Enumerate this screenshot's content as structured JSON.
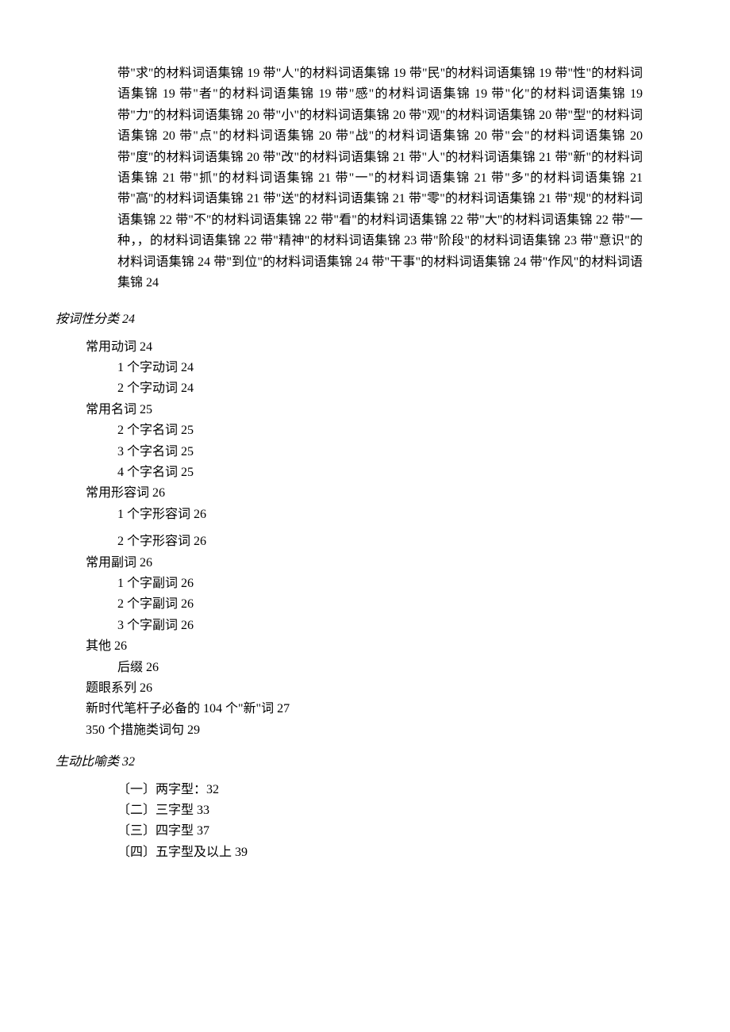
{
  "para1": "带\"求''的材料词语集锦 19 带\"人\"的材料词语集锦 19 带\"民''的材料词语集锦 19 带\"性\"的材料词语集锦 19 带\"者\"的材料词语集锦 19 带\"感\"的材料词语集锦 19 带\"化''的材料词语集锦 19 带\"力''的材料词语集锦 20 带\"小\"的材料词语集锦 20 带\"观\"的材料词语集锦 20 带\"型\"的材料词语集锦 20 带\"点\"的材料词语集锦 20 带\"战''的材料词语集锦 20 带\"会''的材料词语集锦 20 带\"度''的材料词语集锦 20 带\"改\"的材料词语集锦 21 带\"人\"的材料词语集锦 21 带\"新\"的材料词语集锦 21 带\"抓''的材料词语集锦 21 带\"一''的材料词语集锦 21 带\"多''的材料词语集锦 21 带\"高''的材料词语集锦 21 带\"送''的材料词语集锦 21 带\"零\"的材料词语集锦 21 带\"规\"的材料词语集锦 22 带\"不''的材料词语集锦 22 带\"看\"的材料词语集锦 22 带\"大''的材料词语集锦 22 带\"一种，，的材料词语集锦 22 带\"精神\"的材料词语集锦 23 带\"阶段\"的材料词语集锦 23 带\"意识\"的材料词语集锦 24 带\"到位\"的材料词语集锦 24 带\"干事\"的材料词语集锦 24 带\"作风\"的材料词语集锦 24",
  "sec1": {
    "title": "按词性分类 24",
    "items": [
      {
        "label": "常用动词 24",
        "sub": [
          "1 个字动词 24",
          "2 个字动词 24"
        ]
      },
      {
        "label": "常用名词 25",
        "sub": [
          "2 个字名词 25",
          "3 个字名词 25",
          "4 个字名词 25"
        ]
      },
      {
        "label": "常用形容词 26",
        "sub": [
          "1 个字形容词 26"
        ],
        "sub2": [
          "2 个字形容词 26"
        ]
      },
      {
        "label": "常用副词 26",
        "sub": [
          "1 个字副词 26",
          "2 个字副词 26",
          "3 个字副词 26"
        ]
      },
      {
        "label": "其他 26",
        "sub": [
          "后缀 26"
        ]
      },
      {
        "label": "题眼系列 26"
      },
      {
        "label": "新时代笔杆子必备的 104 个\"新\"词 27"
      },
      {
        "label": "350 个措施类词句 29"
      }
    ]
  },
  "sec2": {
    "title": "生动比喻类 32",
    "items": [
      "〔一〕两字型：32",
      "〔二〕三字型 33",
      "〔三〕四字型 37",
      "〔四〕五字型及以上 39"
    ]
  }
}
